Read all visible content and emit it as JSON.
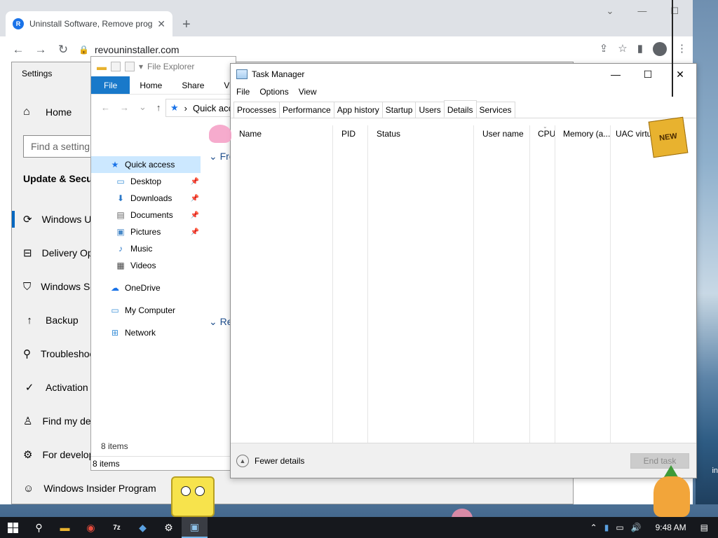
{
  "browser": {
    "tab_title": "Uninstall Software, Remove prog",
    "tab_close": "✕",
    "new_tab": "+",
    "url": "revouninstaller.com",
    "favicon_letter": "R",
    "back": "←",
    "forward": "→",
    "reload": "↻",
    "minimize": "⌄",
    "restore": "—",
    "maximize": "☐",
    "close": "✕"
  },
  "settings": {
    "title": "Settings",
    "home_label": "Home",
    "search_placeholder": "Find a setting",
    "section_title": "Update & Security",
    "nav_items": [
      {
        "label": "Windows Update",
        "icon": "refresh-icon"
      },
      {
        "label": "Delivery Optimization",
        "icon": "delivery-icon"
      },
      {
        "label": "Windows Security",
        "icon": "shield-icon"
      },
      {
        "label": "Backup",
        "icon": "backup-icon"
      },
      {
        "label": "Troubleshoot",
        "icon": "wrench-icon"
      },
      {
        "label": "Activation",
        "icon": "check-circle-icon"
      },
      {
        "label": "Find my device",
        "icon": "person-icon"
      },
      {
        "label": "For developers",
        "icon": "developer-icon"
      },
      {
        "label": "Windows Insider Program",
        "icon": "cat-icon"
      }
    ]
  },
  "explorer": {
    "title": "File Explorer",
    "ribbon_tabs": [
      "File",
      "Home",
      "Share",
      "View"
    ],
    "breadcrumb": "Quick access",
    "nav": [
      {
        "label": "Quick access",
        "icon": "star-icon",
        "selected": true,
        "pinned": false,
        "sub": false
      },
      {
        "label": "Desktop",
        "icon": "desktop-folder-icon",
        "selected": false,
        "pinned": true,
        "sub": true
      },
      {
        "label": "Downloads",
        "icon": "download-folder-icon",
        "selected": false,
        "pinned": true,
        "sub": true
      },
      {
        "label": "Documents",
        "icon": "documents-folder-icon",
        "selected": false,
        "pinned": true,
        "sub": true
      },
      {
        "label": "Pictures",
        "icon": "pictures-folder-icon",
        "selected": false,
        "pinned": true,
        "sub": true
      },
      {
        "label": "Music",
        "icon": "music-icon",
        "selected": false,
        "pinned": false,
        "sub": true
      },
      {
        "label": "Videos",
        "icon": "video-icon",
        "selected": false,
        "pinned": false,
        "sub": true
      },
      {
        "label": "OneDrive",
        "icon": "cloud-icon",
        "selected": false,
        "pinned": false,
        "sub": false
      },
      {
        "label": "My Computer",
        "icon": "computer-icon",
        "selected": false,
        "pinned": false,
        "sub": false
      },
      {
        "label": "Network",
        "icon": "network-icon",
        "selected": false,
        "pinned": false,
        "sub": false
      }
    ],
    "group_frequent": "Fre",
    "group_recent": "Re",
    "items_count": "8 items",
    "status_count": "8 items"
  },
  "taskmgr": {
    "title": "Task Manager",
    "menu": [
      "File",
      "Options",
      "View"
    ],
    "tabs": [
      "Processes",
      "Performance",
      "App history",
      "Startup",
      "Users",
      "Details",
      "Services"
    ],
    "active_tab": "Details",
    "columns": [
      "Name",
      "PID",
      "Status",
      "User name",
      "CPU",
      "Memory (a...",
      "UAC virtual"
    ],
    "fewer_details": "Fewer details",
    "end_task": "End task",
    "minimize": "—",
    "maximize": "☐",
    "close": "✕"
  },
  "overlay": {
    "new_badge": "NEW"
  },
  "taskbar": {
    "time": "9:48 AM",
    "apps": [
      "start",
      "search",
      "file-explorer",
      "chrome",
      "7zip",
      "app",
      "settings",
      "task-manager"
    ],
    "desktop_edge_text": "in"
  }
}
